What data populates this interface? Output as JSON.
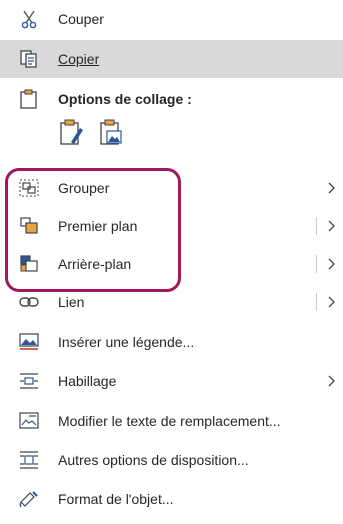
{
  "menu": {
    "cut": {
      "label": "Couper",
      "icon": "scissors-icon"
    },
    "copy": {
      "label": "Copier",
      "icon": "copy-icon"
    },
    "paste_options": {
      "label": "Options de collage :",
      "icon": "clipboard-icon"
    },
    "paste_buttons": [
      {
        "icon": "paste-with-format-icon"
      },
      {
        "icon": "paste-as-picture-icon"
      }
    ],
    "group": {
      "label": "Grouper",
      "icon": "group-icon"
    },
    "bring_front": {
      "label": "Premier plan",
      "icon": "bring-to-front-icon"
    },
    "send_back": {
      "label": "Arrière-plan",
      "icon": "send-to-back-icon"
    },
    "link": {
      "label": "Lien",
      "icon": "link-icon"
    },
    "caption": {
      "label": "Insérer une légende...",
      "icon": "insert-caption-icon"
    },
    "wrap": {
      "label": "Habillage",
      "icon": "wrap-text-icon"
    },
    "alt_text": {
      "label": "Modifier le texte de remplacement...",
      "icon": "alt-text-icon"
    },
    "layout": {
      "label": "Autres options de disposition...",
      "icon": "layout-options-icon"
    },
    "format": {
      "label": "Format de l'objet...",
      "icon": "format-object-icon"
    }
  },
  "colors": {
    "highlight": "#d9d9d9",
    "frame": "#a2185c",
    "icon_blue": "#2b579a",
    "icon_orange": "#e8a33d"
  }
}
